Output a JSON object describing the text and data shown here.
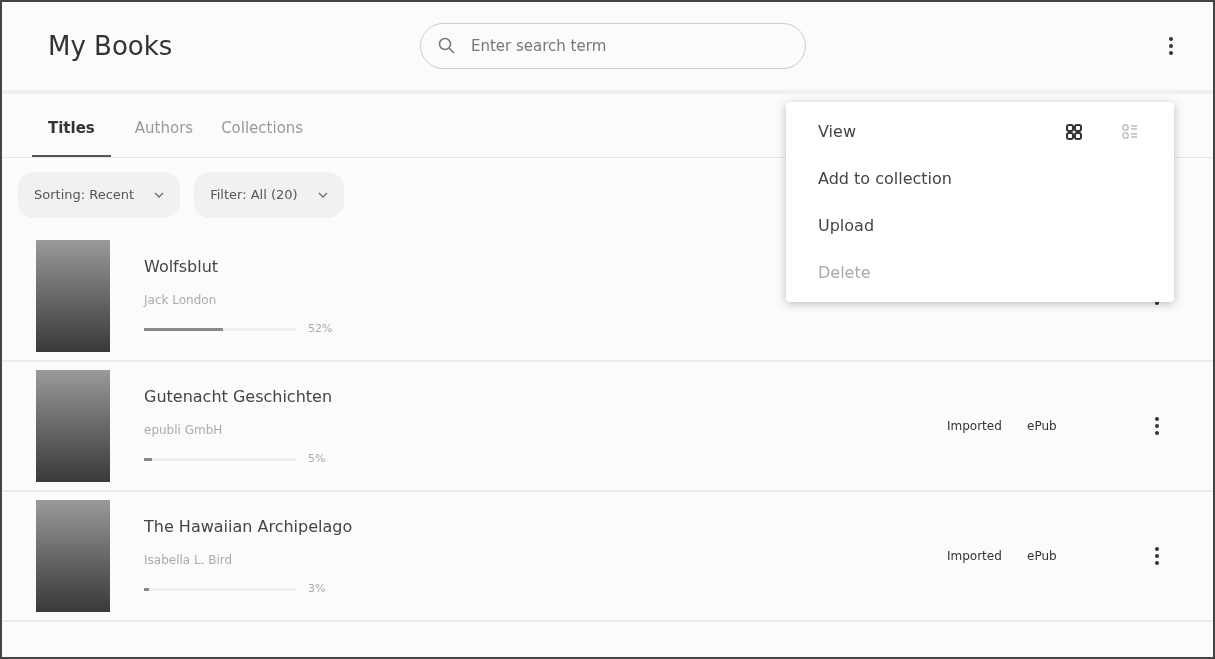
{
  "header": {
    "title": "My Books",
    "search": {
      "placeholder": "Enter search term"
    }
  },
  "tabs": [
    {
      "label": "Titles",
      "selected": true
    },
    {
      "label": "Authors",
      "selected": false
    },
    {
      "label": "Collections",
      "selected": false
    }
  ],
  "filters": [
    {
      "label": "Sorting: Recent"
    },
    {
      "label": "Filter: All (20)"
    }
  ],
  "books": [
    {
      "title": "Wolfsblut",
      "author": "Jack London",
      "level": 0.52,
      "progress": "52%"
    },
    {
      "title": "Gutenacht Geschichten",
      "author": "epubli GmbH",
      "level": 0.05,
      "progress": "5%",
      "status": "Imported",
      "format": "ePub"
    },
    {
      "title": "The Hawaiian Archipelago",
      "author": "Isabella L. Bird",
      "level": 0.03,
      "progress": "3%",
      "status": "Imported",
      "format": "ePub"
    }
  ],
  "menu": {
    "items": [
      {
        "kind": "view",
        "label": "View",
        "options": [
          {
            "kind": "grid",
            "selected": true
          },
          {
            "kind": "list",
            "selected": false
          }
        ]
      },
      {
        "kind": "action",
        "label": "Add to collection",
        "disabled": false
      },
      {
        "kind": "action",
        "label": "Upload",
        "disabled": false
      },
      {
        "kind": "action",
        "label": "Delete",
        "disabled": true
      }
    ]
  }
}
